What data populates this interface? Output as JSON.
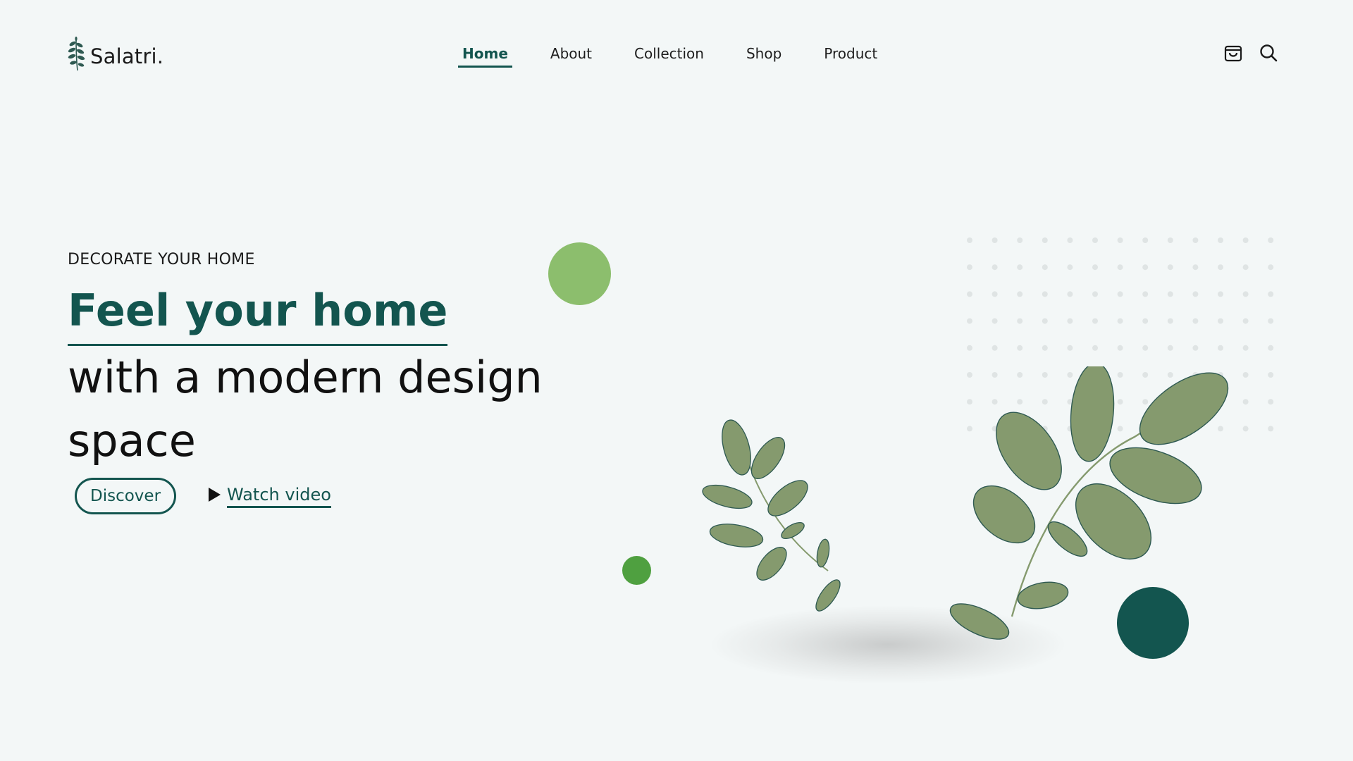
{
  "brand": {
    "name": "Salatri.",
    "logo_icon": "leaf-sprig-icon"
  },
  "nav": {
    "items": [
      {
        "label": "Home",
        "active": true
      },
      {
        "label": "About",
        "active": false
      },
      {
        "label": "Collection",
        "active": false
      },
      {
        "label": "Shop",
        "active": false
      },
      {
        "label": "Product",
        "active": false
      }
    ]
  },
  "header_icons": {
    "cart": "shopping-bag-icon",
    "search": "search-icon"
  },
  "hero": {
    "eyebrow": "DECORATE YOUR HOME",
    "headline_highlight": "Feel your home",
    "headline_rest": "with a modern design space",
    "discover_label": "Discover",
    "watch_label": "Watch video",
    "play_icon": "play-icon"
  },
  "colors": {
    "background": "#f3f7f7",
    "accent_dark": "#13554f",
    "circle_light_green": "#8cbe6d",
    "circle_green": "#4fa040",
    "circle_dark": "#13554f",
    "leaf": "#859a6e",
    "leaf_vein": "#2f5a52",
    "dot_grid": "#dfe4e4"
  }
}
